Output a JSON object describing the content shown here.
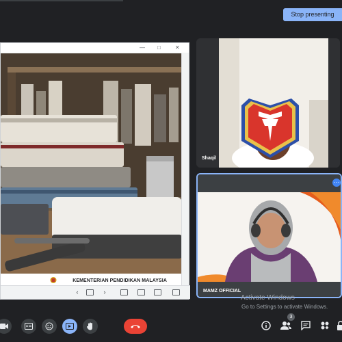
{
  "header": {
    "stop_presenting_label": "Stop presenting"
  },
  "presentation": {
    "footer_text": "KEMENTERIAN PENDIDIKAN MALAYSIA",
    "nav": {
      "prev": "‹",
      "next": "›"
    }
  },
  "participants": [
    {
      "name": "Shaqil"
    },
    {
      "name": "MAMZ OFFICIAL"
    }
  ],
  "watermark": {
    "title": "Activate Windows",
    "subtitle": "Go to Settings to activate Windows."
  },
  "controls": {
    "people_count": "3"
  },
  "colors": {
    "accent": "#8ab4f8",
    "end_call": "#ea4335",
    "background": "#202124"
  }
}
